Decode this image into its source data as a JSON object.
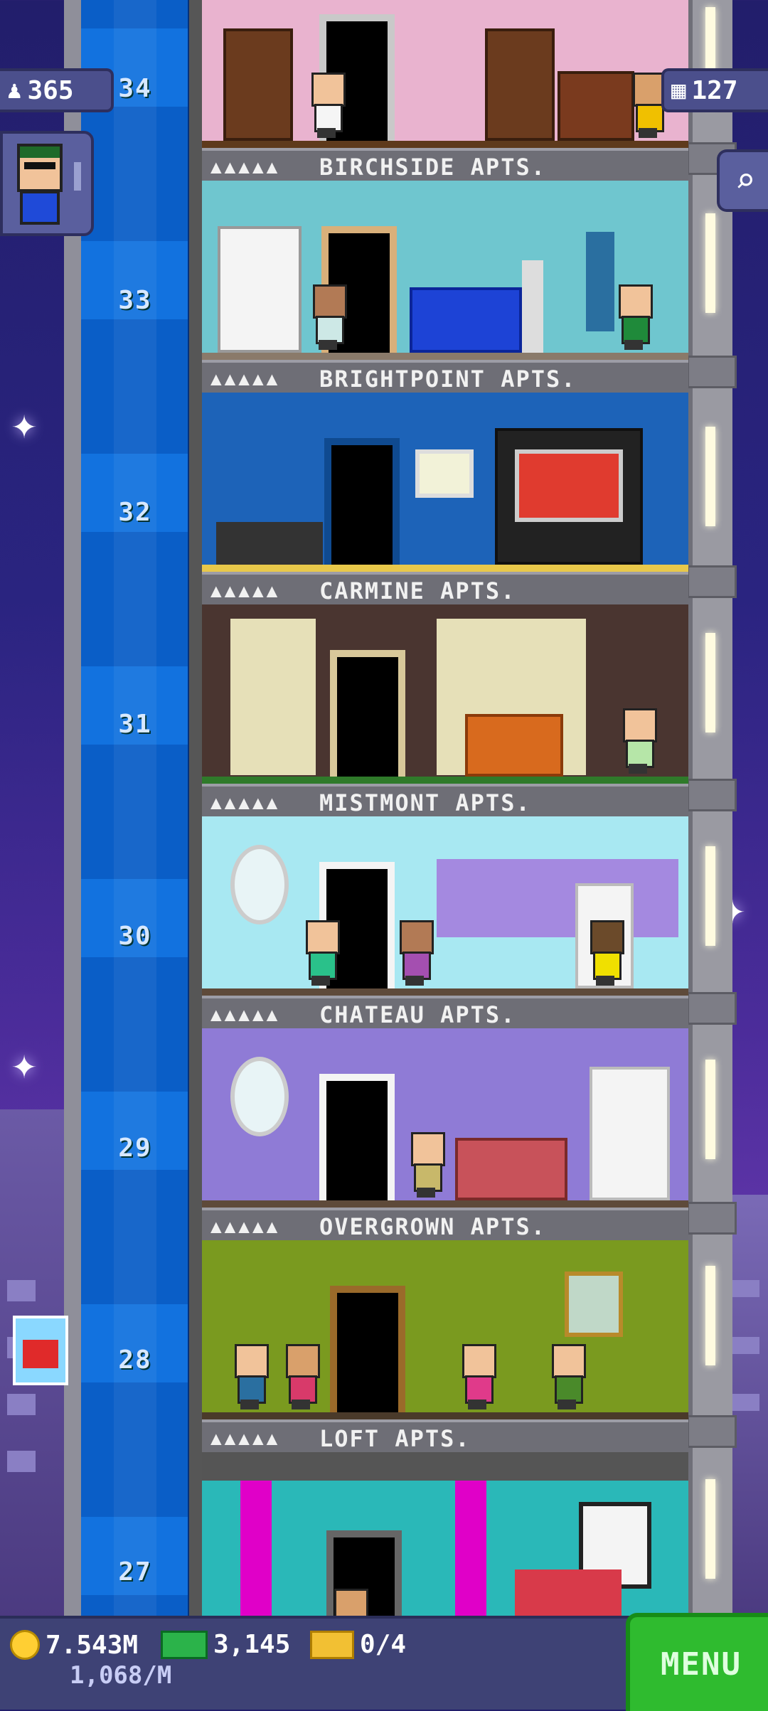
{
  "hud": {
    "population": "365",
    "floors": "127"
  },
  "floors": [
    {
      "number": "34",
      "label": "BIRCHSIDE APTS.",
      "people_icons": "▲▲▲▲▲",
      "room_color": "#e9b3cf"
    },
    {
      "number": "33",
      "label": "BRIGHTPOINT APTS.",
      "people_icons": "▲▲▲▲▲",
      "room_color": "#6fc6cf"
    },
    {
      "number": "32",
      "label": "CARMINE APTS.",
      "people_icons": "▲▲▲▲▲",
      "room_color": "#1d63b8"
    },
    {
      "number": "31",
      "label": "MISTMONT APTS.",
      "people_icons": "▲▲▲▲▲",
      "room_color": "#4a3530"
    },
    {
      "number": "30",
      "label": "CHATEAU APTS.",
      "people_icons": "▲▲▲▲▲",
      "room_color": "#a8e8f2"
    },
    {
      "number": "29",
      "label": "OVERGROWN APTS.",
      "people_icons": "▲▲▲▲▲",
      "room_color": "#8f7bd6"
    },
    {
      "number": "28",
      "label": "LOFT APTS.",
      "people_icons": "▲▲▲▲▲",
      "room_color": "#7a9a1f"
    },
    {
      "number": "27",
      "label": "",
      "people_icons": "",
      "room_color": "#2ab8b8"
    }
  ],
  "bottom": {
    "coins": "7.543M",
    "bux": "3,145",
    "tickets": "0/4",
    "income": "1,068/M",
    "menu_label": "MENU"
  },
  "icons": {
    "population": "person-icon",
    "floors": "building-icon",
    "search": "magnifier-icon",
    "coin": "coin-icon",
    "bux": "cash-icon",
    "ticket": "ticket-icon"
  }
}
